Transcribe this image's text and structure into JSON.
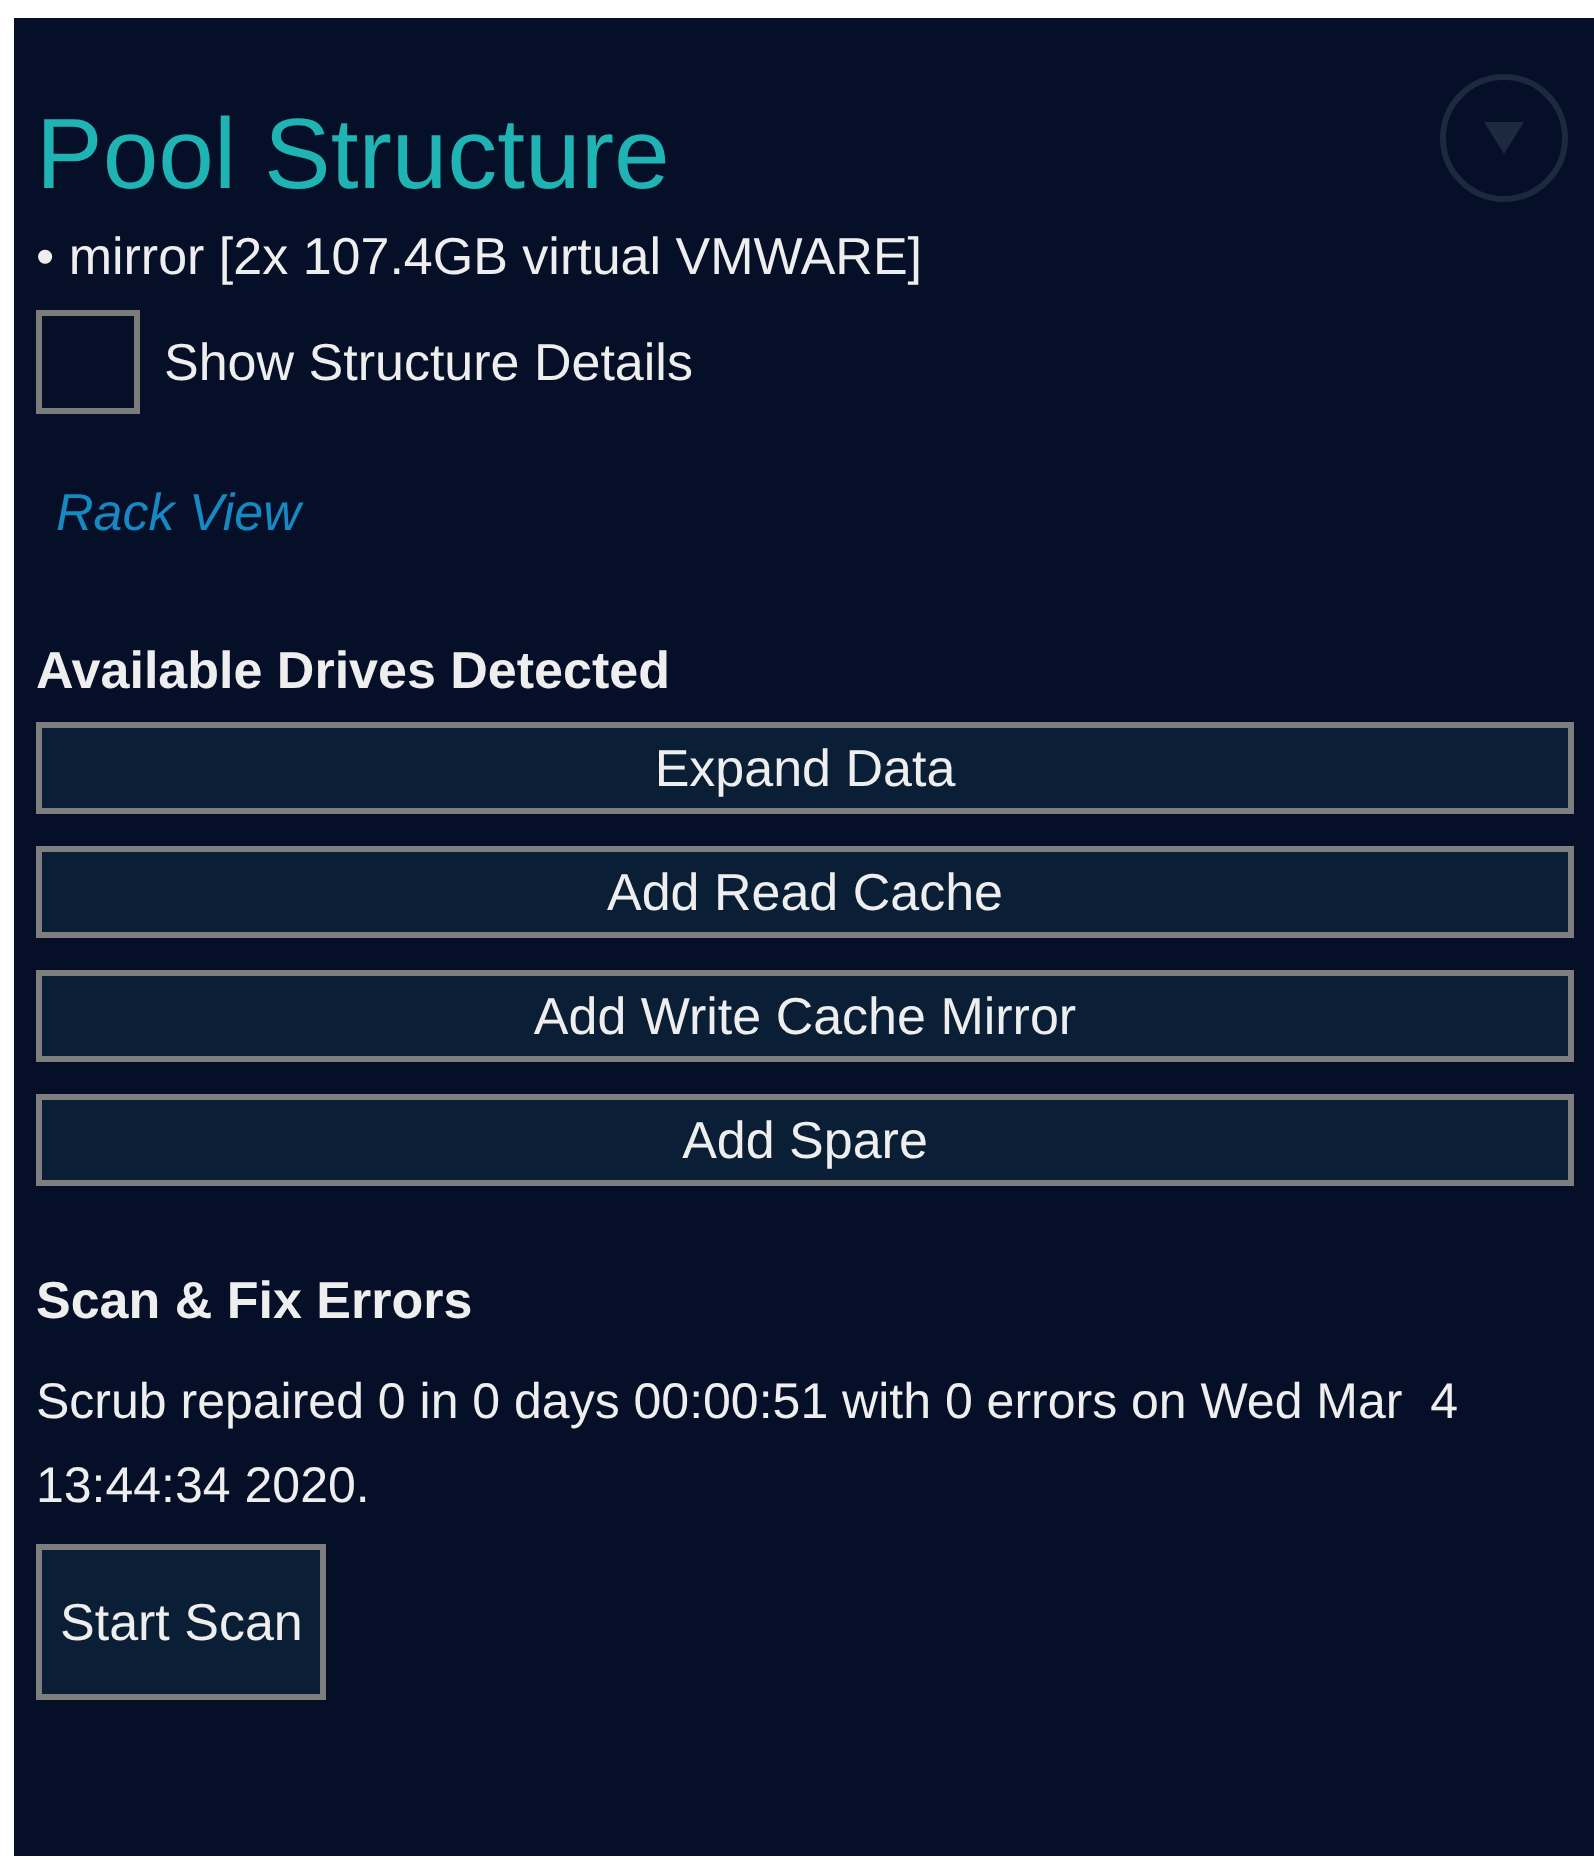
{
  "title": "Pool Structure",
  "collapse_button": {
    "expanded": true
  },
  "structure": [
    "• mirror [2x 107.4GB virtual VMWARE]"
  ],
  "show_details": {
    "label": "Show Structure Details",
    "checked": false
  },
  "rack_view_link": "Rack View",
  "drives": {
    "heading": "Available Drives Detected",
    "buttons": [
      "Expand Data",
      "Add Read Cache",
      "Add Write Cache Mirror",
      "Add Spare"
    ]
  },
  "scan": {
    "heading": "Scan & Fix Errors",
    "status": "Scrub repaired 0 in 0 days 00:00:51 with 0 errors on Wed Mar  4 13:44:34 2020.",
    "button": "Start Scan"
  }
}
